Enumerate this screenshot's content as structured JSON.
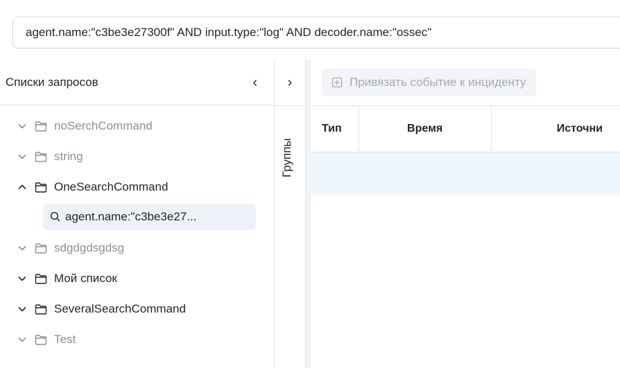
{
  "search": {
    "query": "agent.name:\"c3be3e27300f\" AND input.type:\"log\" AND decoder.name:\"ossec\""
  },
  "sidebar": {
    "title": "Списки запросов",
    "collapse_glyph": "‹",
    "items": [
      {
        "label": "noSerchCommand",
        "expanded": false,
        "dim": true
      },
      {
        "label": "string",
        "expanded": false,
        "dim": true
      },
      {
        "label": "OneSearchCommand",
        "expanded": true,
        "dim": false,
        "children": [
          {
            "label": "agent.name:\"c3be3e27..."
          }
        ]
      },
      {
        "label": "sdgdgdsgdsg",
        "expanded": false,
        "dim": true
      },
      {
        "label": "Мой список",
        "expanded": false,
        "dim": false
      },
      {
        "label": "SeveralSearchCommand",
        "expanded": false,
        "dim": false
      },
      {
        "label": "Test",
        "expanded": false,
        "dim": true
      }
    ]
  },
  "groups": {
    "expand_glyph": "›",
    "label": "Группы"
  },
  "toolbar": {
    "attach_label": "Привязать событие к инциденту"
  },
  "table": {
    "columns": [
      "Тип",
      "Время",
      "Источни"
    ]
  },
  "colors": {
    "dim_text": "#8a8f98",
    "selected_bg": "#eef2f8",
    "row_bg": "#f0f7fc"
  }
}
